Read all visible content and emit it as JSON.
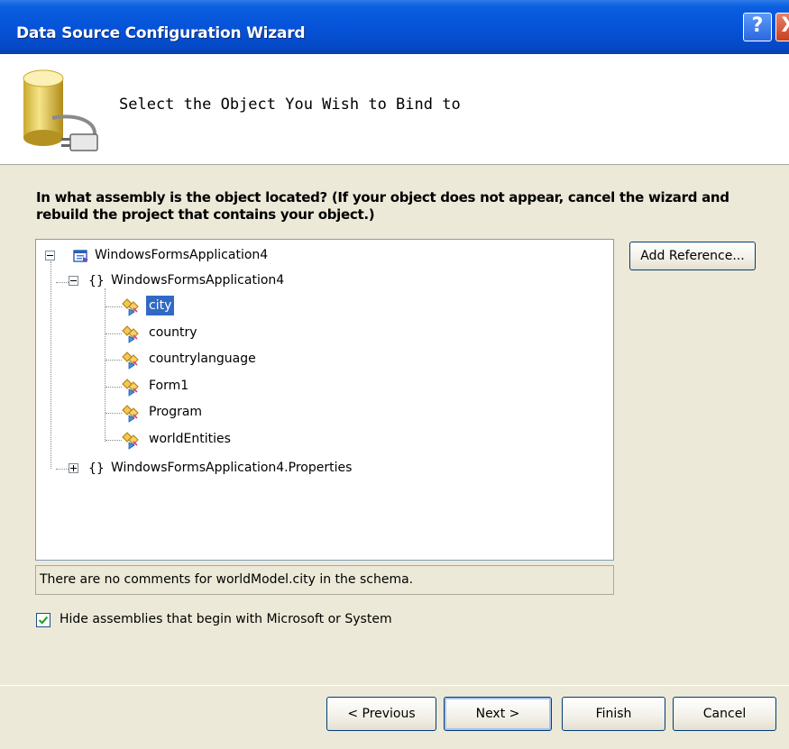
{
  "window": {
    "title": "Data Source Configuration Wizard",
    "help_glyph": "?",
    "close_glyph": "X"
  },
  "header": {
    "heading": "Select the Object You Wish to Bind to",
    "icon": "database-plug-icon"
  },
  "question": "In what assembly is the object located? (If your object does not appear, cancel the wizard and rebuild the project that contains your object.)",
  "tree": {
    "root": {
      "label": "WindowsFormsApplication4",
      "icon": "project-icon"
    },
    "namespace": {
      "label": "WindowsFormsApplication4",
      "icon_text": "{}"
    },
    "classes": [
      {
        "label": "city",
        "selected": true
      },
      {
        "label": "country",
        "selected": false
      },
      {
        "label": "countrylanguage",
        "selected": false
      },
      {
        "label": "Form1",
        "selected": false
      },
      {
        "label": "Program",
        "selected": false
      },
      {
        "label": "worldEntities",
        "selected": false
      }
    ],
    "properties_namespace": {
      "label": "WindowsFormsApplication4.Properties",
      "icon_text": "{}"
    }
  },
  "status_text": "There are no comments for worldModel.city in the schema.",
  "buttons": {
    "add_reference": "Add Reference...",
    "previous": "< Previous",
    "next": "Next >",
    "finish": "Finish",
    "cancel": "Cancel"
  },
  "checkbox": {
    "label": "Hide assemblies that begin with Microsoft or System",
    "checked": true
  },
  "colors": {
    "selection": "#316AC5",
    "titlebar": "#0653D9",
    "dialog_bg": "#ECE9D8"
  }
}
